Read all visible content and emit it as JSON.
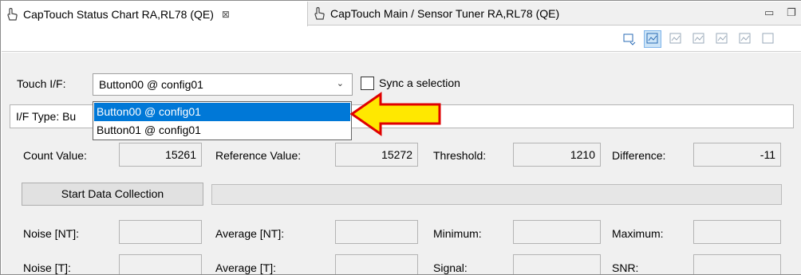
{
  "tabs": [
    {
      "label": "CapTouch Status Chart RA,RL78 (QE)",
      "close": "⊠"
    },
    {
      "label": "CapTouch Main / Sensor Tuner RA,RL78 (QE)"
    }
  ],
  "window_controls": {
    "minimize": "▭",
    "restore": "❐"
  },
  "toolbar": {
    "icons": [
      "chart-refresh-icon",
      "chart-select-icon",
      "chart-icon-3",
      "chart-icon-4",
      "chart-download-icon",
      "chart-upload-icon",
      "chart-more-icon"
    ]
  },
  "touch_if": {
    "label": "Touch I/F:",
    "selected": "Button00 @ config01",
    "arrow": "⌄",
    "options": [
      "Button00 @ config01",
      "Button01 @ config01"
    ]
  },
  "sync": {
    "label": "Sync a selection",
    "checked": false
  },
  "if_type": {
    "label": "I/F Type: Bu"
  },
  "row1": {
    "count_label": "Count Value:",
    "count_value": "15261",
    "ref_label": "Reference Value:",
    "ref_value": "15272",
    "threshold_label": "Threshold:",
    "threshold_value": "1210",
    "diff_label": "Difference:",
    "diff_value": "-11"
  },
  "start_button": "Start Data Collection",
  "progress": {
    "fraction": 0
  },
  "row3": {
    "noise_nt_label": "Noise [NT]:",
    "noise_nt_value": "",
    "avg_nt_label": "Average [NT]:",
    "avg_nt_value": "",
    "min_label": "Minimum:",
    "min_value": "",
    "max_label": "Maximum:",
    "max_value": ""
  },
  "row4": {
    "noise_t_label": "Noise [T]:",
    "noise_t_value": "",
    "avg_t_label": "Average [T]:",
    "avg_t_value": "",
    "signal_label": "Signal:",
    "signal_value": "",
    "snr_label": "SNR:",
    "snr_value": ""
  },
  "colors": {
    "selection": "#0078d7",
    "arrow_fill": "#ffe800",
    "arrow_stroke": "#e00000"
  }
}
